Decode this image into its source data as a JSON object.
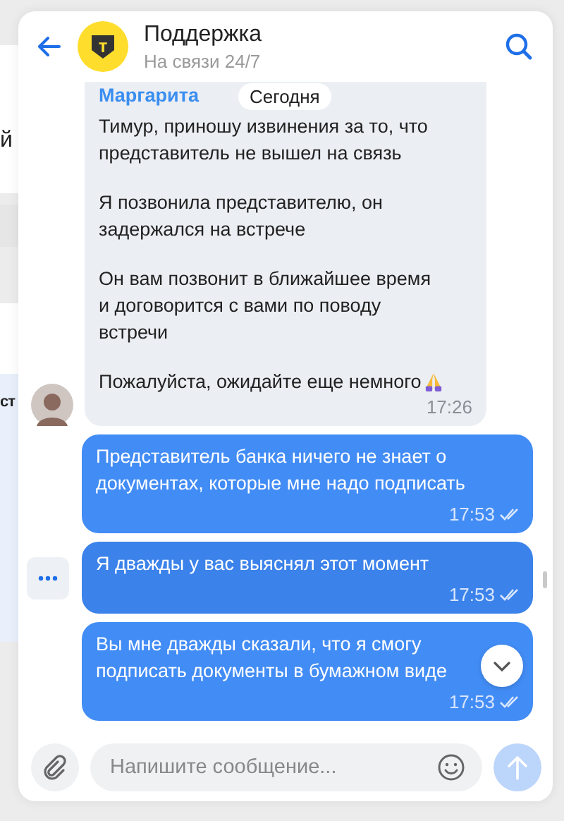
{
  "background_page": {
    "fragments": [
      "й",
      "ст"
    ]
  },
  "header": {
    "logo_letter": "т",
    "title": "Поддержка",
    "subtitle": "На связи 24/7"
  },
  "date_label": "Сегодня",
  "messages": [
    {
      "kind": "incoming",
      "author": "Маргарита",
      "paragraphs": [
        "Тимур, приношу извинения за то, что представитель не вышел на связь",
        "Я позвонила представителю, он задержался на встрече",
        "Он вам позвонит в ближайшее время и договорится с вами по поводу встречи",
        "Пожалуйста, ожидайте еще немного"
      ],
      "emoji_after": true,
      "time": "17:26"
    },
    {
      "kind": "outgoing",
      "paragraphs": [
        "Представитель банка ничего не знает о документах, которые мне надо подписать"
      ],
      "time": "17:53",
      "read": true,
      "highlighted": false
    },
    {
      "kind": "outgoing",
      "paragraphs": [
        "Я дважды у вас выяснял этот момент"
      ],
      "time": "17:53",
      "read": true,
      "highlighted": true
    },
    {
      "kind": "outgoing",
      "paragraphs": [
        "Вы мне дважды сказали, что я смогу подписать документы в бумажном виде"
      ],
      "time": "17:53",
      "read": true,
      "highlighted": false
    }
  ],
  "composer": {
    "placeholder": "Напишите сообщение..."
  }
}
